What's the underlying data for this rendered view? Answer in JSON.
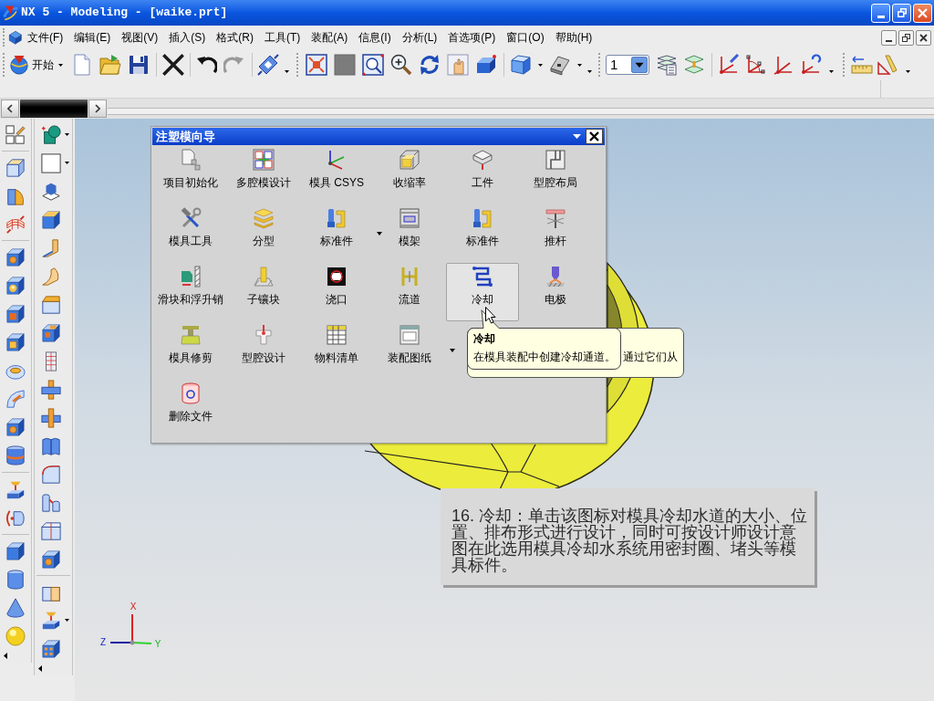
{
  "window": {
    "title": "NX 5 - Modeling - [waike.prt]"
  },
  "menu_bar": {
    "items": [
      "文件(F)",
      "编辑(E)",
      "视图(V)",
      "插入(S)",
      "格式(R)",
      "工具(T)",
      "装配(A)",
      "信息(I)",
      "分析(L)",
      "首选项(P)",
      "窗口(O)",
      "帮助(H)"
    ]
  },
  "toolbar": {
    "start_button": "开始",
    "layer_field": "1"
  },
  "mold_wizard": {
    "title": "注塑模向导",
    "rows": [
      [
        {
          "label": "项目初始化",
          "kind": "button",
          "hovered": false
        },
        {
          "label": "多腔模设计",
          "kind": "button",
          "hovered": false
        },
        {
          "label": "模具 CSYS",
          "kind": "button",
          "hovered": false
        },
        {
          "label": "收缩率",
          "kind": "button",
          "hovered": false
        },
        {
          "label": "工件",
          "kind": "button",
          "hovered": false
        },
        {
          "label": "型腔布局",
          "kind": "button",
          "hovered": false
        }
      ],
      [
        {
          "label": "模具工具",
          "kind": "button",
          "hovered": false
        },
        {
          "label": "分型",
          "kind": "button",
          "hovered": false
        },
        {
          "label": "标准件",
          "kind": "split",
          "hovered": false
        },
        {
          "label": "模架",
          "kind": "button",
          "hovered": false
        },
        {
          "label": "标准件",
          "kind": "button",
          "hovered": false
        },
        {
          "label": "推杆",
          "kind": "button",
          "hovered": false
        }
      ],
      [
        {
          "label": "滑块和浮升销",
          "kind": "button",
          "hovered": false
        },
        {
          "label": "子镶块",
          "kind": "button",
          "hovered": false
        },
        {
          "label": "浇口",
          "kind": "button",
          "hovered": false
        },
        {
          "label": "流道",
          "kind": "button",
          "hovered": false
        },
        {
          "label": "冷却",
          "kind": "button",
          "hovered": true
        },
        {
          "label": "电极",
          "kind": "button",
          "hovered": false
        }
      ],
      [
        {
          "label": "模具修剪",
          "kind": "button",
          "hovered": false
        },
        {
          "label": "型腔设计",
          "kind": "button",
          "hovered": false
        },
        {
          "label": "物料清单",
          "kind": "button",
          "hovered": false
        },
        {
          "label": "装配图纸",
          "kind": "split",
          "hovered": false
        }
      ],
      [
        {
          "label": "删除文件",
          "kind": "button",
          "hovered": false
        }
      ]
    ]
  },
  "back_tooltip": {
    "text": "通过它们从"
  },
  "tooltip": {
    "title": "冷却",
    "text": "在模具装配中创建冷却通道。"
  },
  "annotation": {
    "text": "16. 冷却：单击该图标对模具冷却水道的大小、位置、排布形式进行设计，同时可按设计师设计意图在此选用模具冷却水系统用密封圈、堵头等模具标件。"
  },
  "view_triad": {
    "labels": [
      "X",
      "Z",
      "Y"
    ]
  }
}
